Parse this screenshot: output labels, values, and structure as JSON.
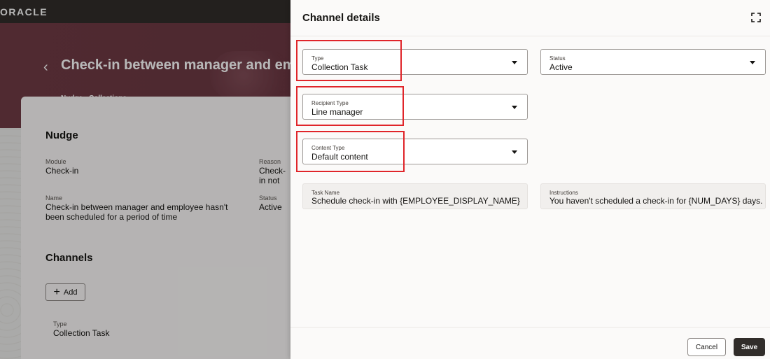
{
  "app": {
    "logo": "ORACLE"
  },
  "page": {
    "back_icon": "chevron-left-icon",
    "title": "Check-in between manager and employee hasn't been scheduled for a period of time",
    "subtitle": "Nudge - Collections"
  },
  "nudge_card": {
    "heading": "Nudge",
    "module_label": "Module",
    "module_value": "Check-in",
    "reason_label": "Reason",
    "reason_value": "Check-in not scheduled",
    "name_label": "Name",
    "name_value": "Check-in between manager and employee hasn't been scheduled for a period of time",
    "status_label": "Status",
    "status_value": "Active",
    "channels_heading": "Channels",
    "add_label": "Add",
    "add_icon": "plus-icon",
    "channel_type_label": "Type",
    "channel_type_value": "Collection Task"
  },
  "drawer": {
    "title": "Channel details",
    "expand_icon": "expand-icon",
    "fields": {
      "type": {
        "label": "Type",
        "value": "Collection Task"
      },
      "status": {
        "label": "Status",
        "value": "Active"
      },
      "recipient_type": {
        "label": "Recipient Type",
        "value": "Line manager"
      },
      "content_type": {
        "label": "Content Type",
        "value": "Default content"
      },
      "task_name": {
        "label": "Task Name",
        "value": "Schedule check-in with {EMPLOYEE_DISPLAY_NAME}"
      },
      "instructions": {
        "label": "Instructions",
        "value": "You haven't scheduled a check-in for {NUM_DAYS} days."
      }
    },
    "cancel_label": "Cancel",
    "save_label": "Save"
  },
  "colors": {
    "hero": "#6f3b44",
    "highlight_box": "#e0252a",
    "save_button": "#312d2a"
  }
}
